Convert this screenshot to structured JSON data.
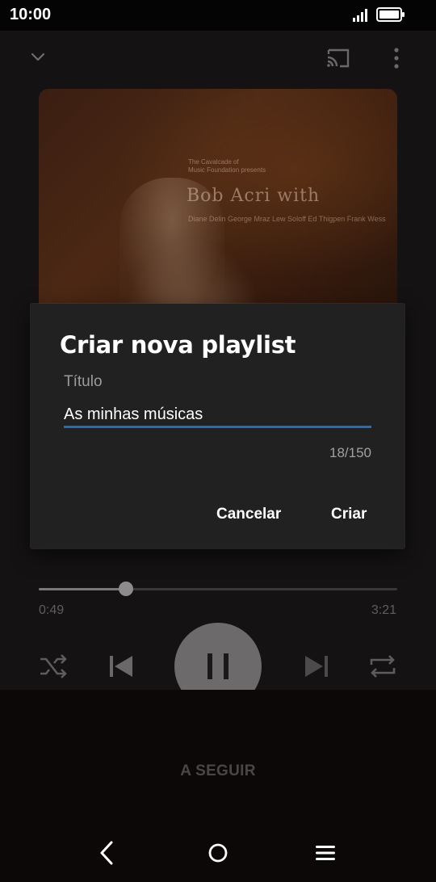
{
  "status_bar": {
    "time": "10:00"
  },
  "album": {
    "small_text_line1": "The Cavalcade of",
    "small_text_line2": "Music Foundation presents",
    "artist": "Bob Acri with",
    "names": "Diane Delin George Mraz Lew Soloff Ed Thigpen Frank Wess"
  },
  "player": {
    "elapsed": "0:49",
    "total": "3:21",
    "progress_fraction": 0.244,
    "up_next_label": "A SEGUIR"
  },
  "dialog": {
    "title": "Criar nova playlist",
    "field_label": "Título",
    "field_value": "As minhas músicas",
    "counter": "18/150",
    "cancel_label": "Cancelar",
    "create_label": "Criar"
  },
  "colors": {
    "accent": "#1e6fbf",
    "dialog_bg": "#212121"
  },
  "icons": {
    "collapse": "chevron-down-icon",
    "cast": "cast-icon",
    "more": "more-vertical-icon",
    "shuffle": "shuffle-icon",
    "previous": "skip-previous-icon",
    "pause": "pause-icon",
    "next": "skip-next-icon",
    "repeat": "repeat-icon",
    "back": "nav-back-icon",
    "home": "nav-home-icon",
    "menu": "nav-menu-icon"
  }
}
